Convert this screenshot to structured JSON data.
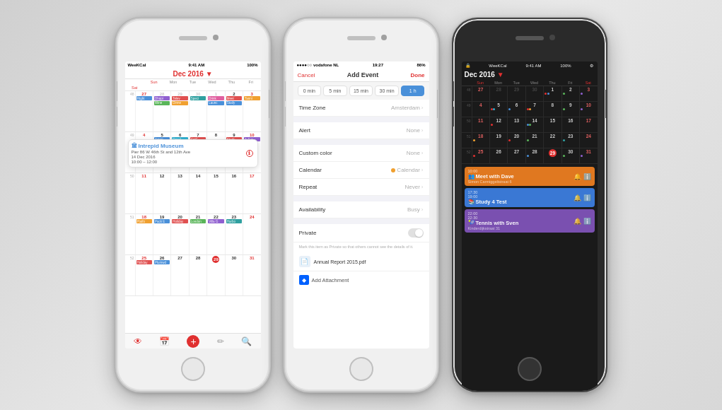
{
  "background": "#d8d8d8",
  "phone1": {
    "status": {
      "carrier": "WeeKCal",
      "time": "9:41 AM",
      "battery": "100%"
    },
    "header": {
      "month": "Dec 2016",
      "dropdown_arrow": "▼"
    },
    "weekdays": [
      "Sun",
      "Mon",
      "Tue",
      "Wed",
      "Thu",
      "Fri",
      "Sat"
    ],
    "popup": {
      "icon": "🏛",
      "title": "Intrepid Museum",
      "address": "Pier 86 W 46th St and 12th Ave",
      "date": "14 Dec 2016",
      "time": "10:00 – 12:00"
    },
    "toolbar": {
      "icons": [
        "👁",
        "📅",
        "✏",
        "🔍"
      ]
    }
  },
  "phone2": {
    "status": {
      "carrier": "●●●●○○ vodafone NL",
      "wifi": "WiFi",
      "time": "19:27",
      "battery": "86%"
    },
    "nav": {
      "cancel": "Cancel",
      "title": "Add Event",
      "done": "Done"
    },
    "time_buttons": [
      {
        "label": "0 min",
        "active": false
      },
      {
        "label": "5 min",
        "active": false
      },
      {
        "label": "15 min",
        "active": false
      },
      {
        "label": "30 min",
        "active": false
      },
      {
        "label": "1 h",
        "active": true
      }
    ],
    "rows": [
      {
        "label": "Time Zone",
        "value": "Amsterdam",
        "has_chevron": true
      },
      {
        "label": "",
        "value": "",
        "is_separator": true
      },
      {
        "label": "Alert",
        "value": "None",
        "has_chevron": true
      },
      {
        "label": "",
        "value": "",
        "is_separator": true
      },
      {
        "label": "Custom color",
        "value": "None",
        "has_chevron": true
      },
      {
        "label": "Calendar",
        "value": "Calendar",
        "has_dot": true,
        "has_chevron": true
      },
      {
        "label": "Repeat",
        "value": "Never",
        "has_chevron": true
      },
      {
        "label": "",
        "value": "",
        "is_separator": true
      },
      {
        "label": "Availability",
        "value": "Busy",
        "has_chevron": true
      },
      {
        "label": "",
        "value": "",
        "is_separator": true
      },
      {
        "label": "Private",
        "value": "",
        "has_toggle": true
      }
    ],
    "private_hint": "Mark this item as Private so that others cannot see the details of it.",
    "attachment": {
      "filename": "Annual Report 2015.pdf"
    },
    "add_attachment_label": "Add Attachment"
  },
  "phone3": {
    "status": {
      "lock": "🔒",
      "carrier": "WeeKCal",
      "time": "9:41 AM",
      "battery": "100%",
      "gear": "⚙"
    },
    "header": {
      "month": "Dec 2016",
      "dropdown_arrow": "▼"
    },
    "weekdays": [
      "Sun",
      "Mon",
      "Tue",
      "Wed",
      "Thu",
      "Fri",
      "Sat"
    ],
    "events": [
      {
        "color": "orange",
        "time_start": "10:00",
        "time_end": "",
        "icon": "👥",
        "title": "Meet with Dave",
        "sub": "Simon Carmiggeltstraat 6"
      },
      {
        "color": "blue",
        "time_start": "17:30",
        "time_end": "19:00",
        "icon": "📚",
        "title": "Study 4 Test",
        "sub": ""
      },
      {
        "color": "purple",
        "time_start": "22:00",
        "time_end": "22:30",
        "icon": "🎾",
        "title": "Tennis with Sven",
        "sub": "Kinderdijkstraat 31"
      }
    ]
  }
}
